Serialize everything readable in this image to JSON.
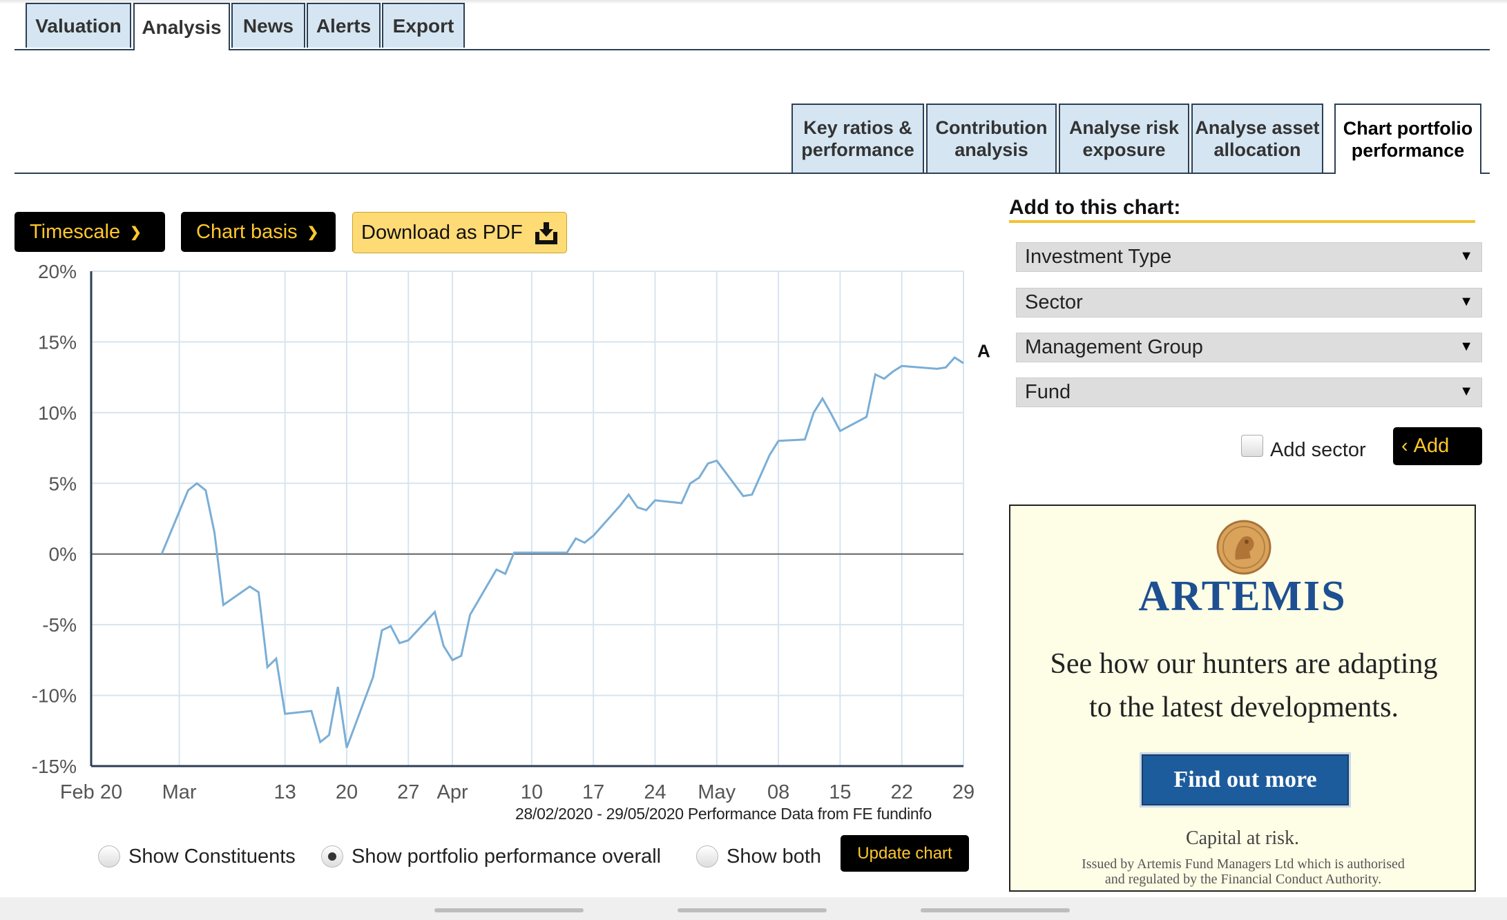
{
  "main_tabs": [
    {
      "label": "Valuation",
      "active": false
    },
    {
      "label": "Analysis",
      "active": true
    },
    {
      "label": "News",
      "active": false
    },
    {
      "label": "Alerts",
      "active": false
    },
    {
      "label": "Export",
      "active": false
    }
  ],
  "sub_tabs": [
    {
      "line1": "Key ratios &",
      "line2": "performance",
      "active": false
    },
    {
      "line1": "Contribution",
      "line2": "analysis",
      "active": false
    },
    {
      "line1": "Analyse risk",
      "line2": "exposure",
      "active": false
    },
    {
      "line1": "Analyse asset",
      "line2": "allocation",
      "active": false
    },
    {
      "line1": "Chart portfolio",
      "line2": "performance",
      "active": true
    }
  ],
  "toolbar": {
    "timescale_label": "Timescale",
    "chart_basis_label": "Chart basis",
    "download_label": "Download as PDF"
  },
  "chart_data": {
    "type": "line",
    "x": [
      "2020-02-28",
      "2020-03-02",
      "2020-03-03",
      "2020-03-04",
      "2020-03-05",
      "2020-03-06",
      "2020-03-09",
      "2020-03-10",
      "2020-03-11",
      "2020-03-12",
      "2020-03-13",
      "2020-03-16",
      "2020-03-17",
      "2020-03-18",
      "2020-03-19",
      "2020-03-20",
      "2020-03-23",
      "2020-03-24",
      "2020-03-25",
      "2020-03-26",
      "2020-03-27",
      "2020-03-30",
      "2020-03-31",
      "2020-04-01",
      "2020-04-02",
      "2020-04-03",
      "2020-04-06",
      "2020-04-07",
      "2020-04-08",
      "2020-04-09",
      "2020-04-14",
      "2020-04-15",
      "2020-04-16",
      "2020-04-17",
      "2020-04-20",
      "2020-04-21",
      "2020-04-22",
      "2020-04-23",
      "2020-04-24",
      "2020-04-27",
      "2020-04-28",
      "2020-04-29",
      "2020-04-30",
      "2020-05-01",
      "2020-05-04",
      "2020-05-05",
      "2020-05-06",
      "2020-05-07",
      "2020-05-08",
      "2020-05-11",
      "2020-05-12",
      "2020-05-13",
      "2020-05-14",
      "2020-05-15",
      "2020-05-18",
      "2020-05-19",
      "2020-05-20",
      "2020-05-21",
      "2020-05-22",
      "2020-05-26",
      "2020-05-27",
      "2020-05-28",
      "2020-05-29"
    ],
    "y": [
      0.0,
      4.5,
      5.0,
      4.5,
      1.5,
      -3.6,
      -2.3,
      -2.7,
      -8.0,
      -7.4,
      -11.3,
      -11.1,
      -13.3,
      -12.8,
      -9.4,
      -13.7,
      -8.7,
      -5.4,
      -5.1,
      -6.3,
      -6.1,
      -4.1,
      -6.5,
      -7.5,
      -7.2,
      -4.3,
      -1.1,
      -1.4,
      0.1,
      0.1,
      0.1,
      1.1,
      0.8,
      1.3,
      3.4,
      4.2,
      3.3,
      3.1,
      3.8,
      3.6,
      5.0,
      5.4,
      6.4,
      6.6,
      4.1,
      4.2,
      5.6,
      7.0,
      8.0,
      8.1,
      10.0,
      11.0,
      9.9,
      8.7,
      9.7,
      12.7,
      12.4,
      12.9,
      13.3,
      13.1,
      13.2,
      13.9,
      13.5,
      14.9,
      14.4
    ],
    "x_ticks": [
      {
        "date": "2020-02-20",
        "label": "Feb 20"
      },
      {
        "date": "2020-03-01",
        "label": "Mar"
      },
      {
        "date": "2020-03-13",
        "label": "13"
      },
      {
        "date": "2020-03-20",
        "label": "20"
      },
      {
        "date": "2020-03-27",
        "label": "27"
      },
      {
        "date": "2020-04-01",
        "label": "Apr"
      },
      {
        "date": "2020-04-10",
        "label": "10"
      },
      {
        "date": "2020-04-17",
        "label": "17"
      },
      {
        "date": "2020-04-24",
        "label": "24"
      },
      {
        "date": "2020-05-01",
        "label": "May"
      },
      {
        "date": "2020-05-08",
        "label": "08"
      },
      {
        "date": "2020-05-15",
        "label": "15"
      },
      {
        "date": "2020-05-22",
        "label": "22"
      },
      {
        "date": "2020-05-29",
        "label": "29"
      }
    ],
    "y_ticks": [
      {
        "value": 20,
        "label": "20%"
      },
      {
        "value": 15,
        "label": "15%"
      },
      {
        "value": 10,
        "label": "10%"
      },
      {
        "value": 5,
        "label": "5%"
      },
      {
        "value": 0,
        "label": "0%"
      },
      {
        "value": -5,
        "label": "-5%"
      },
      {
        "value": -10,
        "label": "-10%"
      },
      {
        "value": -15,
        "label": "-15%"
      }
    ],
    "xlim": [
      "2020-02-20",
      "2020-05-29"
    ],
    "ylim": [
      -15,
      20
    ],
    "grid": true,
    "series_marker": "A",
    "source_text": "28/02/2020 - 29/05/2020 Performance Data from FE fundinfo",
    "colors": {
      "line": "#7aaed6",
      "grid": "#d6e4ef",
      "zero": "#666666",
      "axis": "#2b3f55"
    }
  },
  "display": {
    "options": [
      {
        "label": "Show Constituents",
        "selected": false
      },
      {
        "label": "Show portfolio performance overall",
        "selected": true
      },
      {
        "label": "Show both",
        "selected": false
      }
    ],
    "update_label": "Update chart"
  },
  "side": {
    "title": "Add to this chart:",
    "selects": [
      "Investment Type",
      "Sector",
      "Management Group",
      "Fund"
    ],
    "checkbox_label": "Add sector",
    "add_label": "Add"
  },
  "ad": {
    "brand": "ARTEMIS",
    "headline_line1": "See how our hunters are adapting",
    "headline_line2": "to the latest developments.",
    "cta": "Find out more",
    "risk": "Capital at risk.",
    "fine_line1": "Issued by Artemis Fund Managers Ltd which is authorised",
    "fine_line2": "and regulated by the Financial Conduct Authority."
  },
  "colors": {
    "accent": "#ffc82c",
    "tab_bg": "#d5e6f2",
    "brand_blue": "#1d4f91"
  }
}
